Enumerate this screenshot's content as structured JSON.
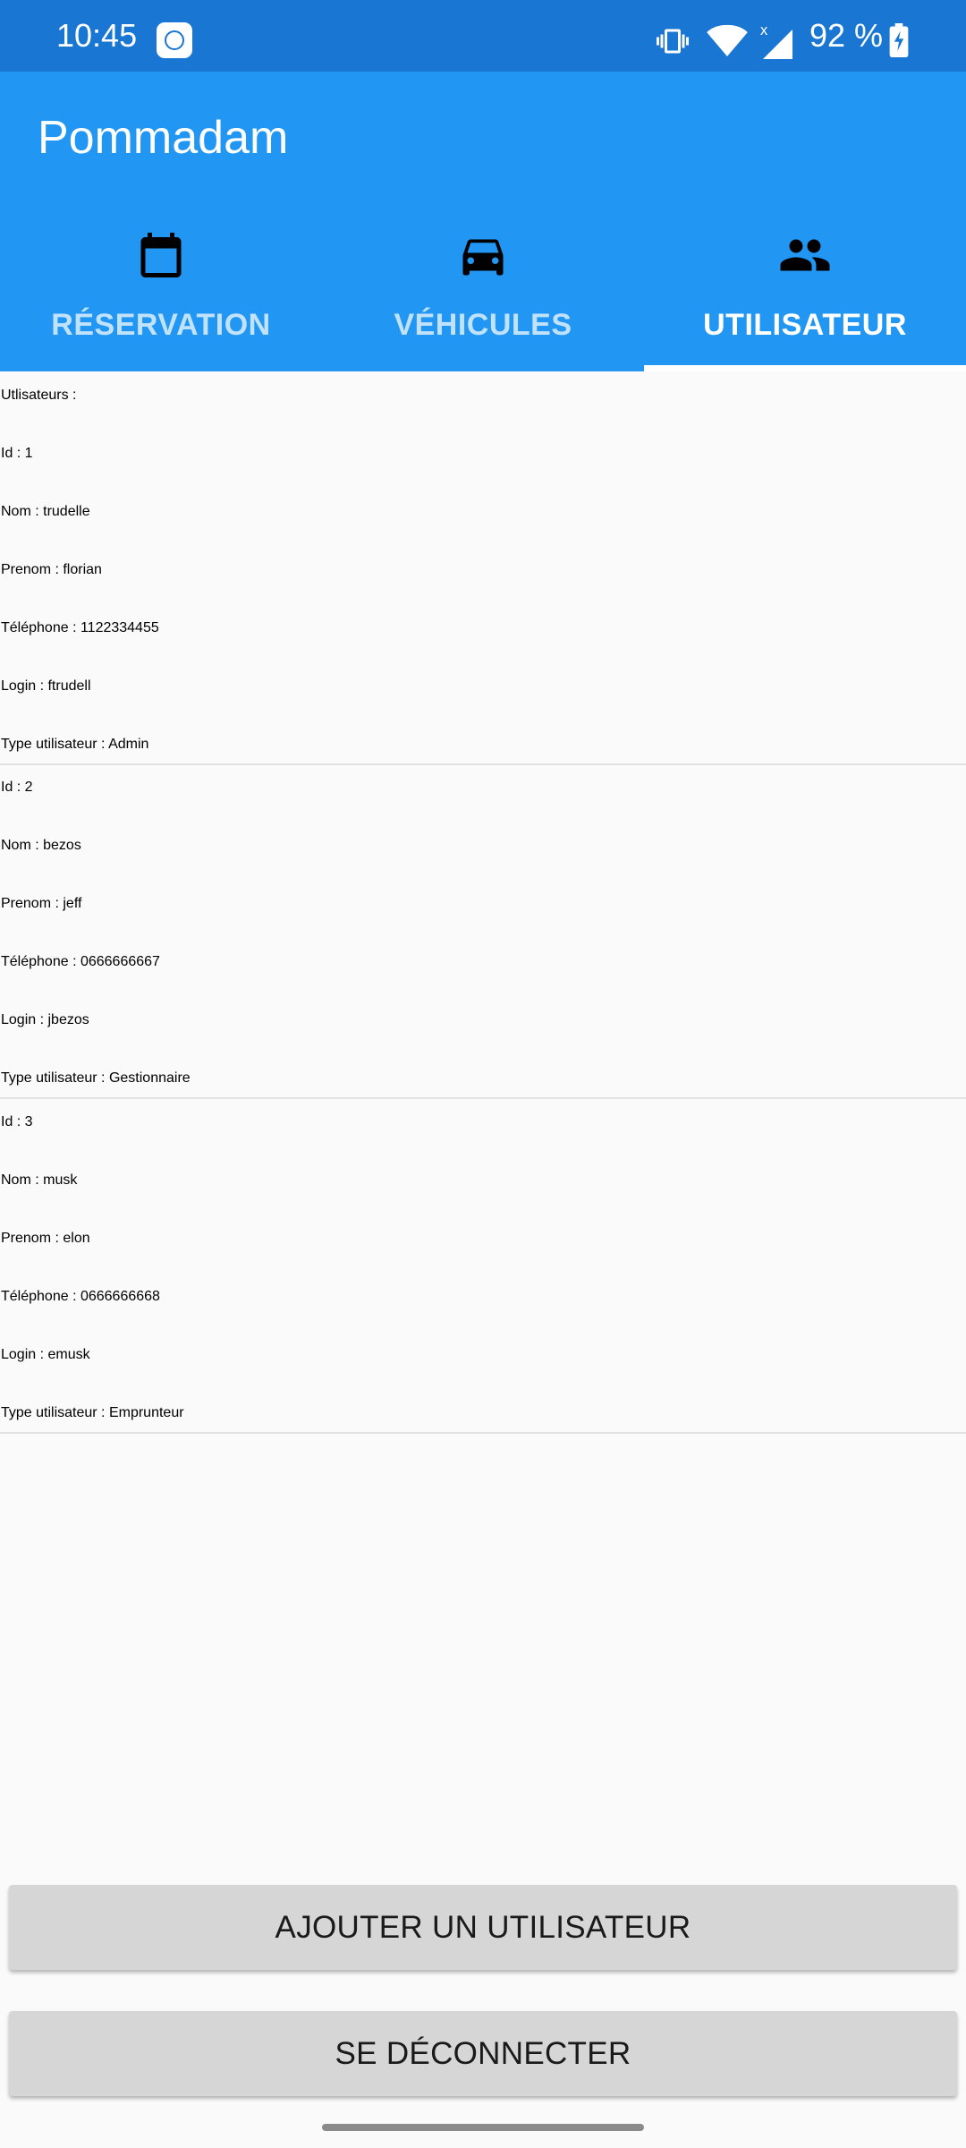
{
  "status_bar": {
    "time": "10:45",
    "battery": "92 %",
    "icons": [
      "app-notification-icon",
      "vibrate-icon",
      "wifi-icon",
      "signal-icon",
      "battery-charging-icon"
    ]
  },
  "app": {
    "title": "Pommadam",
    "primary_color": "#2196f3",
    "status_color": "#1976d2"
  },
  "tabs": [
    {
      "label": "RÉSERVATION",
      "icon": "calendar-icon",
      "active": false
    },
    {
      "label": "VÉHICULES",
      "icon": "car-icon",
      "active": false
    },
    {
      "label": "UTILISATEUR",
      "icon": "people-icon",
      "active": true
    }
  ],
  "users_header": "Utlisateurs :",
  "users": [
    {
      "id": "Id : 1",
      "nom": "Nom : trudelle",
      "prenom": "Prenom : florian",
      "telephone": "Téléphone : 1122334455",
      "login": "Login : ftrudell",
      "type": "Type utilisateur : Admin"
    },
    {
      "id": "Id : 2",
      "nom": "Nom : bezos",
      "prenom": "Prenom : jeff",
      "telephone": "Téléphone : 0666666667",
      "login": "Login : jbezos",
      "type": "Type utilisateur : Gestionnaire"
    },
    {
      "id": "Id : 3",
      "nom": "Nom : musk",
      "prenom": "Prenom : elon",
      "telephone": "Téléphone : 0666666668",
      "login": "Login : emusk",
      "type": "Type utilisateur : Emprunteur"
    }
  ],
  "buttons": {
    "add_user": "AJOUTER UN UTILISATEUR",
    "logout": "SE DÉCONNECTER"
  }
}
